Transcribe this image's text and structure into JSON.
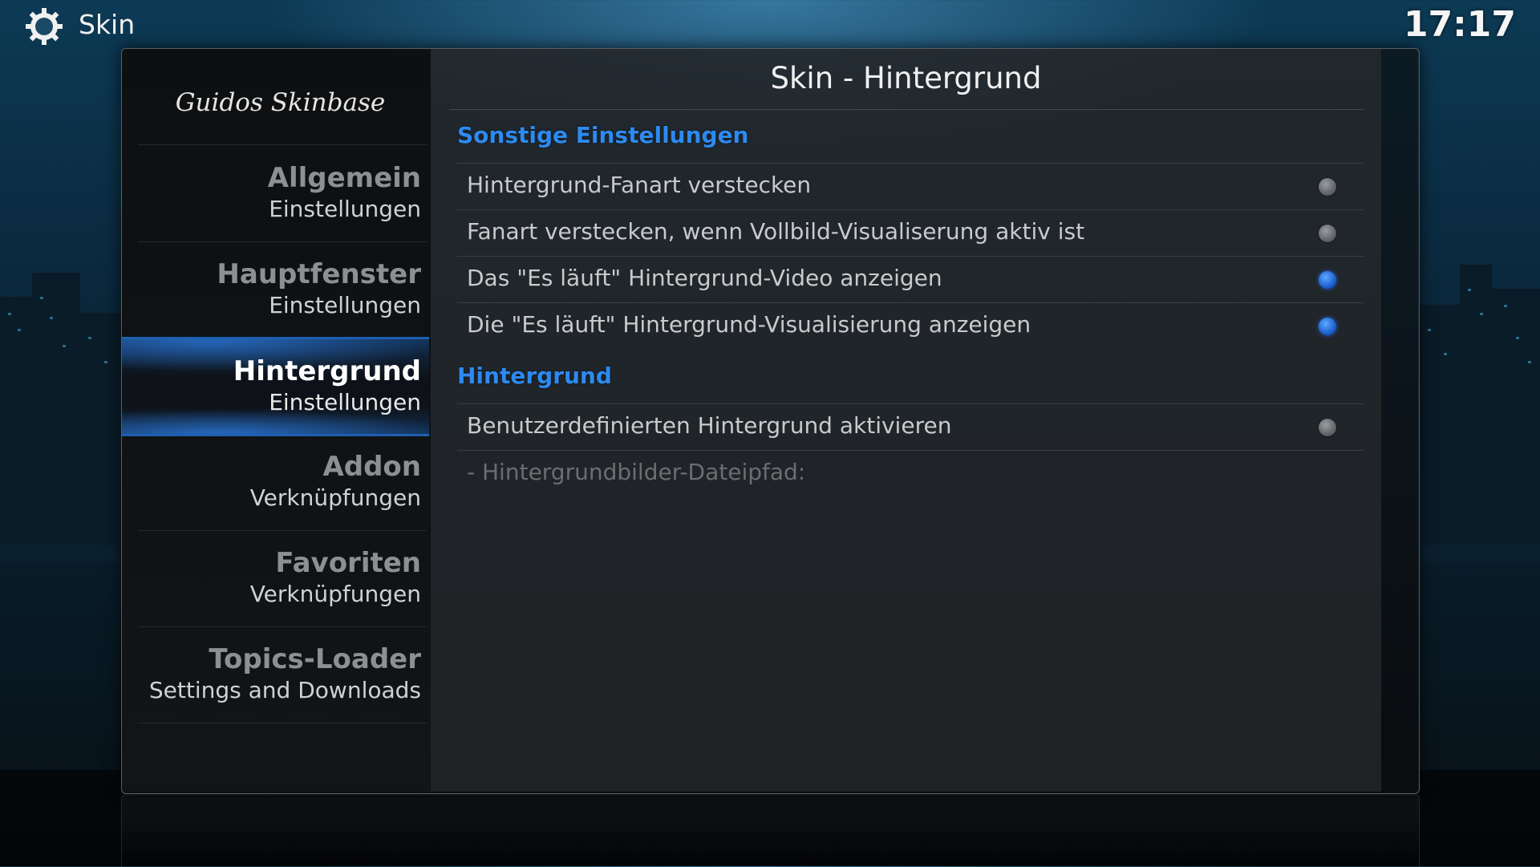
{
  "topbar": {
    "icon": "gear-icon",
    "title": "Skin",
    "clock": "17:17"
  },
  "dialog": {
    "logo": "Guidos Skinbase",
    "title": "Skin - Hintergrund"
  },
  "sidebar": {
    "items": [
      {
        "title": "Allgemein",
        "subtitle": "Einstellungen",
        "active": false
      },
      {
        "title": "Hauptfenster",
        "subtitle": "Einstellungen",
        "active": false
      },
      {
        "title": "Hintergrund",
        "subtitle": "Einstellungen",
        "active": true
      },
      {
        "title": "Addon",
        "subtitle": "Verknüpfungen",
        "active": false
      },
      {
        "title": "Favoriten",
        "subtitle": "Verknüpfungen",
        "active": false
      },
      {
        "title": "Topics-Loader",
        "subtitle": "Settings and Downloads",
        "active": false
      }
    ]
  },
  "sections": [
    {
      "heading": "Sonstige Einstellungen",
      "rows": [
        {
          "label": "Hintergrund-Fanart verstecken",
          "toggle": "off"
        },
        {
          "label": "Fanart verstecken, wenn Vollbild-Visualiserung aktiv ist",
          "toggle": "off"
        },
        {
          "label": "Das \"Es läuft\" Hintergrund-Video anzeigen",
          "toggle": "on"
        },
        {
          "label": "Die \"Es läuft\" Hintergrund-Visualisierung anzeigen",
          "toggle": "on"
        }
      ]
    },
    {
      "heading": "Hintergrund",
      "rows": [
        {
          "label": "Benutzerdefinierten Hintergrund aktivieren",
          "toggle": "off"
        },
        {
          "label": "- Hintergrundbilder-Dateipfad:",
          "disabled": true
        }
      ]
    }
  ],
  "colors": {
    "accent": "#2d8af0",
    "toggle_on": "#1656c8",
    "toggle_off": "#5a5d60"
  }
}
